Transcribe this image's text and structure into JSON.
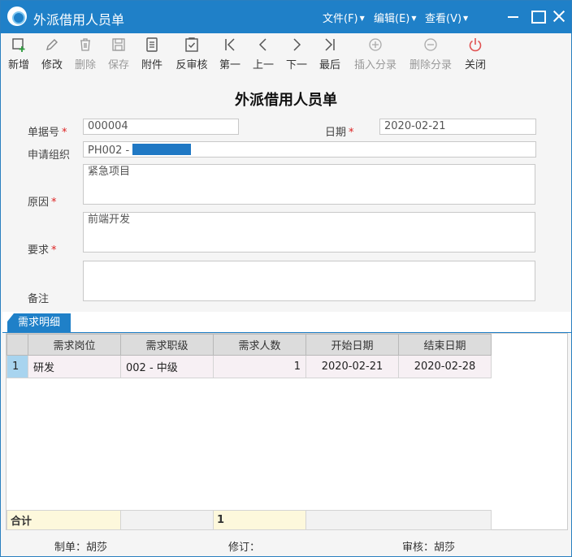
{
  "window": {
    "title": "外派借用人员单",
    "menus": [
      {
        "label": "文件(F)"
      },
      {
        "label": "编辑(E)"
      },
      {
        "label": "查看(V)"
      }
    ]
  },
  "toolbar": {
    "new": "新增",
    "edit": "修改",
    "delete": "删除",
    "save": "保存",
    "attach": "附件",
    "unaudit": "反审核",
    "first": "第一",
    "prev": "上一",
    "next": "下一",
    "last": "最后",
    "insert_entry": "插入分录",
    "delete_entry": "删除分录",
    "close": "关闭"
  },
  "form": {
    "heading": "外派借用人员单",
    "doc_no_label": "单据号",
    "doc_no": "000004",
    "date_label": "日期",
    "date": "2020-02-21",
    "org_label": "申请组织",
    "org": "PH002 -",
    "reason_label": "原因",
    "reason": "紧急项目",
    "require_label": "要求",
    "require": "前端开发",
    "remark_label": "备注",
    "remark": "",
    "required_mark": "*"
  },
  "detail": {
    "tab_label": "需求明细",
    "columns": [
      "需求岗位",
      "需求职级",
      "需求人数",
      "开始日期",
      "结束日期"
    ],
    "rows": [
      {
        "num": "1",
        "position": "研发",
        "level": "002 - 中级",
        "count": "1",
        "start": "2020-02-21",
        "end": "2020-02-28"
      }
    ],
    "total_label": "合计",
    "total_count": "1"
  },
  "footer": {
    "maker": "制单：胡莎",
    "revise": "修订：",
    "auditor": "审核：胡莎"
  },
  "colors": {
    "accent": "#1f80c8",
    "required": "#dd2222",
    "close_icon": "#e05050"
  }
}
